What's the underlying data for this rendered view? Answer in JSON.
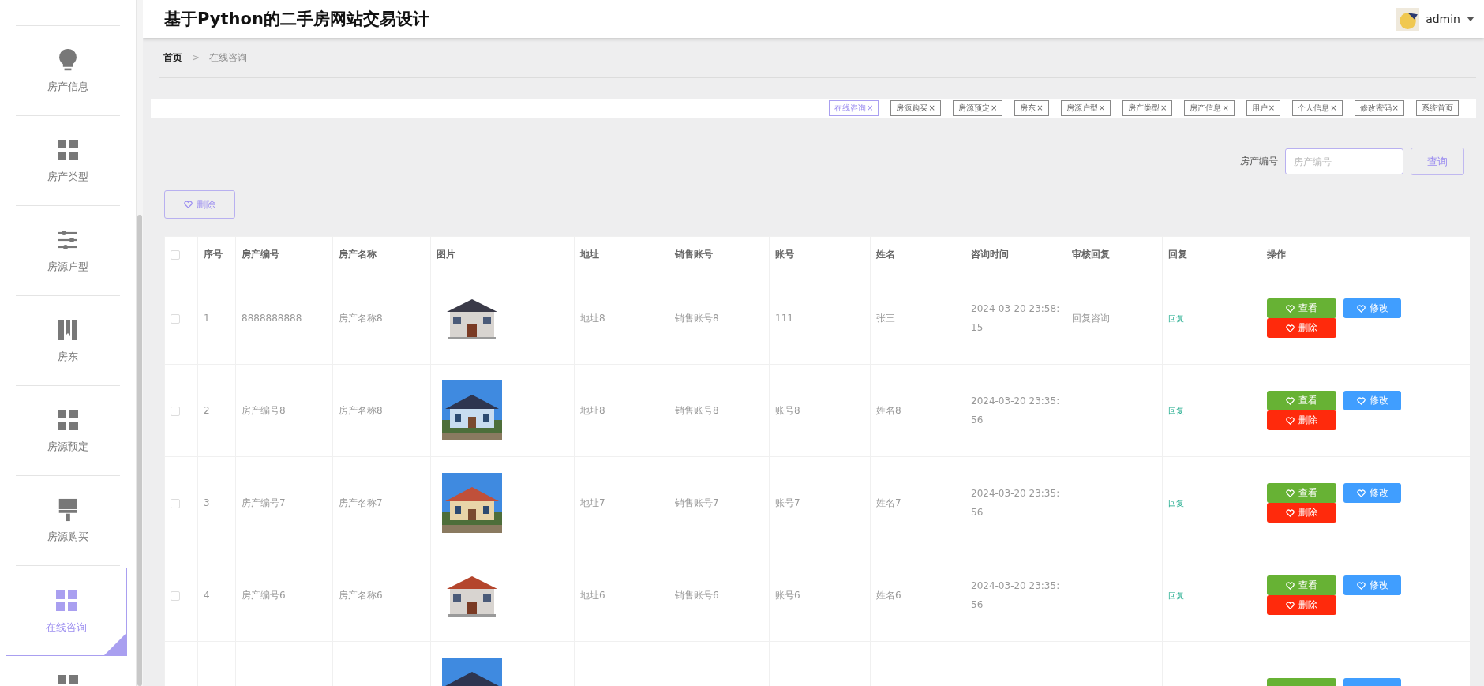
{
  "header": {
    "title": "基于Python的二手房网站交易设计",
    "user": "admin"
  },
  "sidebar": {
    "items": [
      {
        "label": "房产信息",
        "kind": "bulb",
        "selected": false
      },
      {
        "label": "房产类型",
        "kind": "grid",
        "selected": false
      },
      {
        "label": "房源户型",
        "kind": "sliders",
        "selected": false
      },
      {
        "label": "房东",
        "kind": "book",
        "selected": false
      },
      {
        "label": "房源预定",
        "kind": "grid",
        "selected": false
      },
      {
        "label": "房源购买",
        "kind": "brush",
        "selected": false
      },
      {
        "label": "在线咨询",
        "kind": "grid",
        "selected": true
      },
      {
        "kind": "grid",
        "selected": false
      }
    ]
  },
  "breadcrumb": {
    "items": [
      "首页",
      "在线咨询"
    ],
    "separator": ">"
  },
  "tabs": [
    {
      "label": "在线咨询",
      "close": "×",
      "selected": true
    },
    {
      "label": "房源购买",
      "close": "×",
      "selected": false
    },
    {
      "label": "房源预定",
      "close": "×",
      "selected": false
    },
    {
      "label": "房东",
      "close": "×",
      "selected": false
    },
    {
      "label": "房源户型",
      "close": "×",
      "selected": false
    },
    {
      "label": "房产类型",
      "close": "×",
      "selected": false
    },
    {
      "label": "房产信息",
      "close": "×",
      "selected": false
    },
    {
      "label": "用户",
      "close": "×",
      "selected": false
    },
    {
      "label": "个人信息",
      "close": "×",
      "selected": false
    },
    {
      "label": "修改密码",
      "close": "×",
      "selected": false
    },
    {
      "label": "系统首页",
      "selected": false
    }
  ],
  "search": {
    "label": "房产编号",
    "placeholder": "房产编号",
    "button": "查询"
  },
  "delete_button": "删除",
  "table": {
    "select_all": {
      "checked": false
    },
    "columns": [
      "序号",
      "房产编号",
      "房产名称",
      "图片",
      "地址",
      "销售账号",
      "账号",
      "姓名",
      "咨询时间",
      "审核回复",
      "回复",
      "操作"
    ],
    "rows": [
      {
        "checked": false,
        "cells": [
          "1",
          "8888888888",
          "房产名称8",
          "地址8",
          "销售账号8",
          "111",
          "张三",
          "2024-03-20 23:58:15",
          "回复咨询"
        ],
        "reply": "回复",
        "picture": {
          "kind": "picture"
        },
        "actions": [
          {
            "label": "查看",
            "kind": "view"
          },
          {
            "label": "修改",
            "kind": "edit"
          },
          {
            "label": "删除",
            "kind": "delete"
          }
        ]
      },
      {
        "checked": false,
        "cells": [
          "2",
          "房产编号8",
          "房产名称8",
          "地址8",
          "销售账号8",
          "账号8",
          "姓名8",
          "2024-03-20 23:35:56"
        ],
        "reply": "回复",
        "picture": {
          "kind": "picture"
        },
        "actions": [
          {
            "label": "查看",
            "kind": "view"
          },
          {
            "label": "修改",
            "kind": "edit"
          },
          {
            "label": "删除",
            "kind": "delete"
          }
        ]
      },
      {
        "checked": false,
        "cells": [
          "3",
          "房产编号7",
          "房产名称7",
          "地址7",
          "销售账号7",
          "账号7",
          "姓名7",
          "2024-03-20 23:35:56"
        ],
        "reply": "回复",
        "picture": {
          "kind": "picture"
        },
        "actions": [
          {
            "label": "查看",
            "kind": "view"
          },
          {
            "label": "修改",
            "kind": "edit"
          },
          {
            "label": "删除",
            "kind": "delete"
          }
        ]
      },
      {
        "checked": false,
        "cells": [
          "4",
          "房产编号6",
          "房产名称6",
          "地址6",
          "销售账号6",
          "账号6",
          "姓名6",
          "2024-03-20 23:35:56"
        ],
        "reply": "回复",
        "picture": {
          "kind": "picture"
        },
        "actions": [
          {
            "label": "查看",
            "kind": "view"
          },
          {
            "label": "修改",
            "kind": "edit"
          },
          {
            "label": "删除",
            "kind": "delete"
          }
        ]
      },
      {
        "picture": {
          "kind": "picture"
        },
        "actions": [
          {
            "kind": "view"
          },
          {
            "kind": "edit"
          }
        ]
      }
    ]
  }
}
